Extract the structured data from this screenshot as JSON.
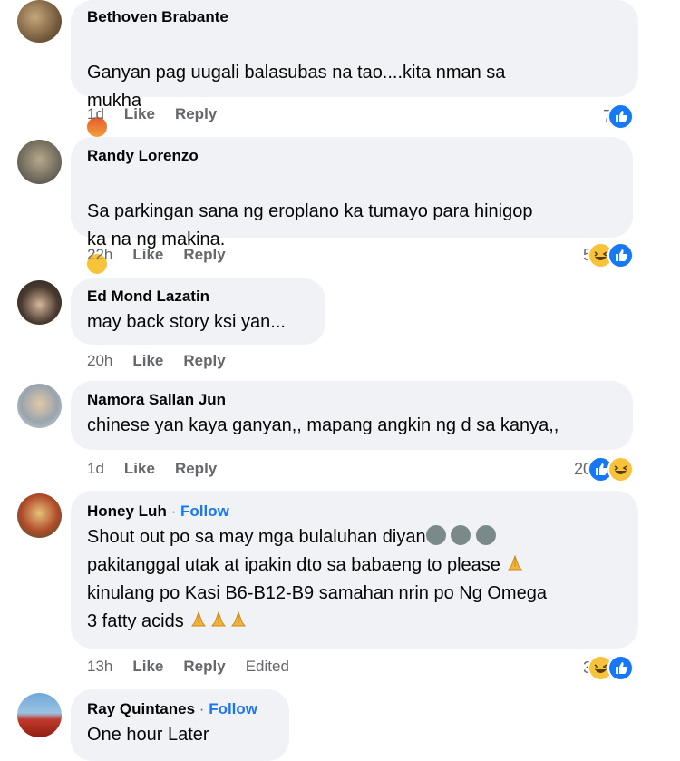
{
  "comments": [
    {
      "author": "Bethoven Brabante",
      "text": "Ganyan pag uugali balasubas na tao....kita nman sa\nmukha",
      "time": "1d",
      "like": "Like",
      "reply": "Reply",
      "count": "7"
    },
    {
      "author": "Randy Lorenzo",
      "text": "Sa parkingan sana ng eroplano ka tumayo para hinigop\nka na ng makina.",
      "time": "22h",
      "like": "Like",
      "reply": "Reply",
      "count": "5"
    },
    {
      "author": "Ed Mond Lazatin",
      "text": "may back story ksi yan...",
      "time": "20h",
      "like": "Like",
      "reply": "Reply"
    },
    {
      "author": "Namora Sallan Jun",
      "text": "chinese yan kaya ganyan,, mapang angkin ng d sa kanya,,",
      "time": "1d",
      "like": "Like",
      "reply": "Reply",
      "count": "20"
    },
    {
      "author": "Honey Luh",
      "follow": "Follow",
      "text_lines": [
        "Shout out po sa may mga bulaluhan diyan",
        "pakitanggal utak at ipakin dto sa babaeng to please",
        "kinulang po Kasi B6-B12-B9 samahan nrin po Ng Omega",
        "3 fatty acids"
      ],
      "time": "13h",
      "like": "Like",
      "reply": "Reply",
      "edited": "Edited",
      "count": "3"
    },
    {
      "author": "Ray Quintanes",
      "follow": "Follow",
      "text": "One hour Later"
    }
  ],
  "dot": "·"
}
